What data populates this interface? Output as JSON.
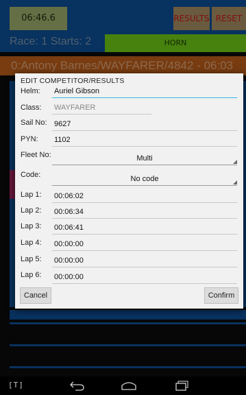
{
  "app": {
    "timer": "06:46.6",
    "results_label": "RESULTS",
    "reset_label": "RESET",
    "race_label": "Race: 1 Starts: 2",
    "horn_label": "HORN",
    "competitor_row": "0:Antony Barnes/WAYFARER/4842 - 06:03"
  },
  "dialog": {
    "title": "EDIT COMPETITOR/RESULTS",
    "helm_label": "Helm:",
    "helm_value": "Auriel Gibson",
    "class_label": "Class:",
    "class_value": "WAYFARER",
    "sail_label": "Sail No:",
    "sail_value": "9627",
    "pyn_label": "PYN:",
    "pyn_value": "1102",
    "fleet_label": "Fleet No:",
    "fleet_value": "Multi",
    "code_label": "Code:",
    "code_value": "No code",
    "laps": [
      {
        "label": "Lap 1:",
        "value": "00:06:02"
      },
      {
        "label": "Lap 2:",
        "value": "00:06:34"
      },
      {
        "label": "Lap 3:",
        "value": "00:06:41"
      },
      {
        "label": "Lap 4:",
        "value": "00:00:00"
      },
      {
        "label": "Lap 5:",
        "value": "00:00:00"
      },
      {
        "label": "Lap 6:",
        "value": "00:00:00"
      }
    ],
    "cancel_label": "Cancel",
    "confirm_label": "Confirm"
  },
  "navbar": {
    "keyboard_label": "[T]",
    "icons": [
      "back-icon",
      "home-icon",
      "recents-icon"
    ]
  },
  "colors": {
    "app_blue": "#0d4d93",
    "timer_bg": "#9bab6a",
    "results_reset_text": "#c51a1a",
    "horn_bg": "#6dc716",
    "competitor_bg": "#b95d1a",
    "focus_underline": "#33b5e5"
  }
}
